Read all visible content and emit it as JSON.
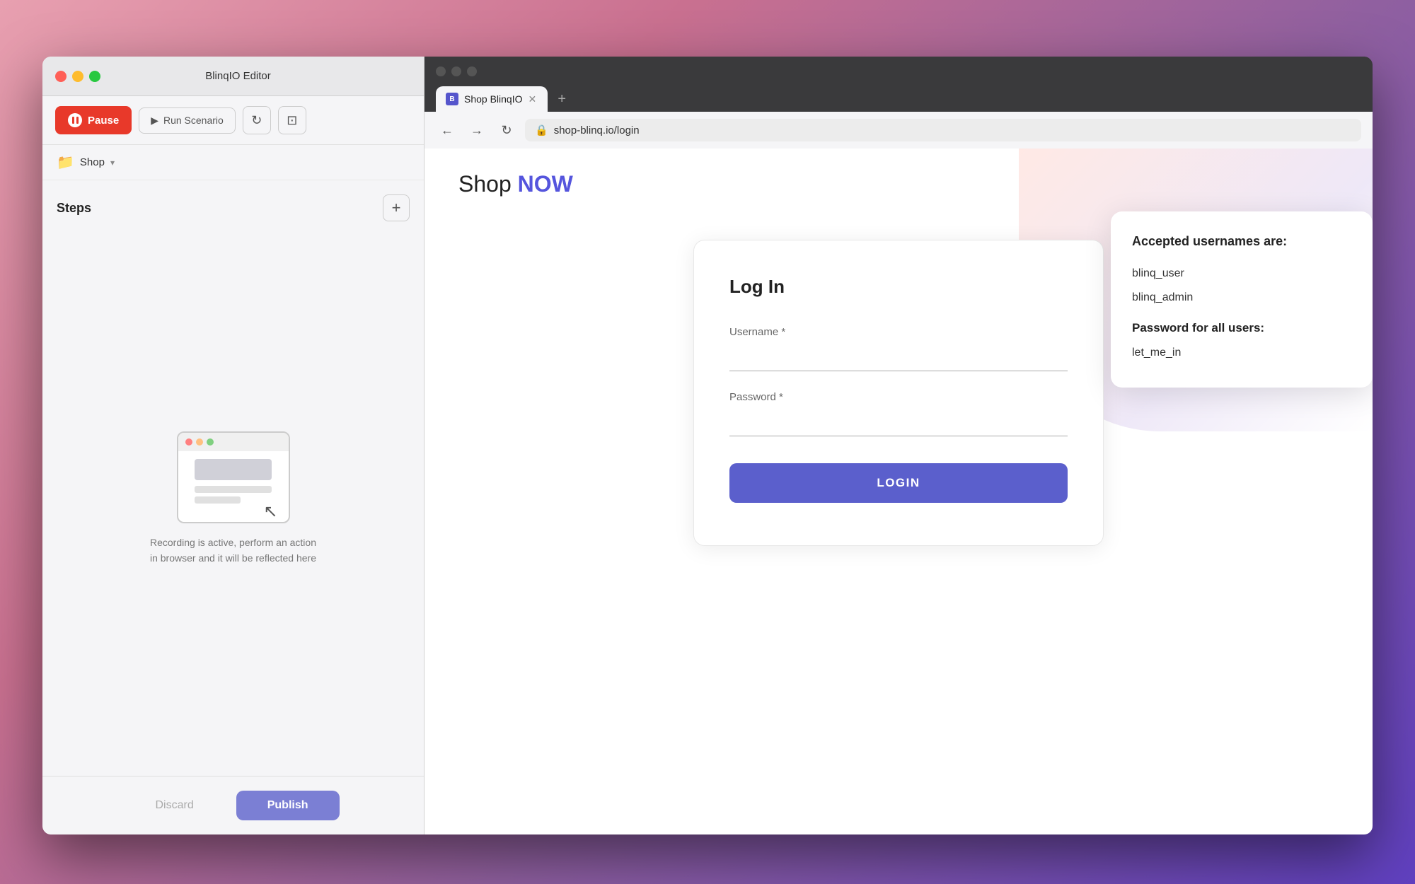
{
  "editor": {
    "title": "BlinqIO Editor",
    "traffic_lights": [
      "red",
      "yellow",
      "green"
    ],
    "toolbar": {
      "pause_label": "Pause",
      "run_scenario_label": "Run Scenario"
    },
    "folder": {
      "name": "Shop"
    },
    "steps": {
      "title": "Steps",
      "add_icon": "+"
    },
    "recording": {
      "line1": "Recording is active, perform an action",
      "line2": "in browser and it will be reflected here"
    },
    "bottom": {
      "discard_label": "Discard",
      "publish_label": "Publish"
    }
  },
  "browser": {
    "tab": {
      "title": "Shop BlinqIO",
      "favicon_text": "B"
    },
    "nav": {
      "back_icon": "←",
      "forward_icon": "→",
      "reload_icon": "↻",
      "url": "shop-blinq.io/login",
      "lock_icon": "🔒"
    },
    "page": {
      "header_part1": "Shop ",
      "header_part2": "NOW",
      "login_card": {
        "title": "Log In",
        "username_label": "Username *",
        "username_placeholder": "",
        "password_label": "Password *",
        "password_placeholder": "",
        "login_button": "LOGIN"
      },
      "credentials_card": {
        "title": "Accepted usernames are:",
        "usernames": [
          "blinq_user",
          "blinq_admin"
        ],
        "password_title": "Password for all users:",
        "password": "let_me_in"
      }
    }
  }
}
